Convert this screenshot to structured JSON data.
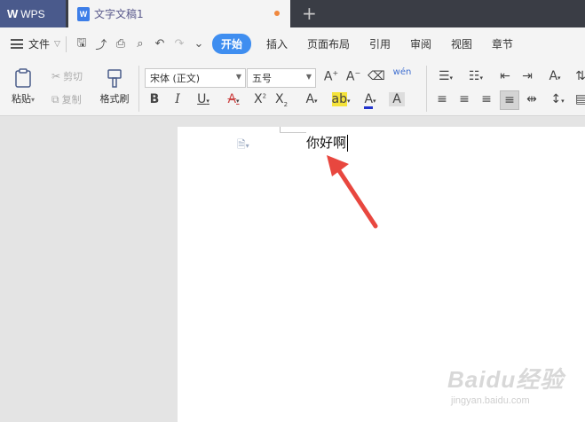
{
  "titlebar": {
    "app_name": "WPS",
    "doc_tab_title": "文字文稿1",
    "doc_icon_letter": "W",
    "new_tab_symbol": "+"
  },
  "menubar": {
    "file_label": "文件",
    "tabs": [
      {
        "label": "开始",
        "active": true
      },
      {
        "label": "插入"
      },
      {
        "label": "页面布局"
      },
      {
        "label": "引用"
      },
      {
        "label": "审阅"
      },
      {
        "label": "视图"
      },
      {
        "label": "章节"
      }
    ]
  },
  "ribbon": {
    "paste_label": "粘贴",
    "cut_label": "剪切",
    "copy_label": "复制",
    "format_painter_label": "格式刷",
    "font_name": "宋体 (正文)",
    "font_size": "五号",
    "phonetic_label": "wén"
  },
  "document": {
    "text": "你好啊"
  },
  "watermark": {
    "brand": "Baidu经验",
    "url": "jingyan.baidu.com"
  },
  "colors": {
    "titlebar_bg": "#3a3d45",
    "wps_tab_bg": "#4a5a8c",
    "active_tab_bg": "#3f8ef0",
    "arrow_red": "#e8473f",
    "doc_icon_blue": "#3d7ee8"
  }
}
